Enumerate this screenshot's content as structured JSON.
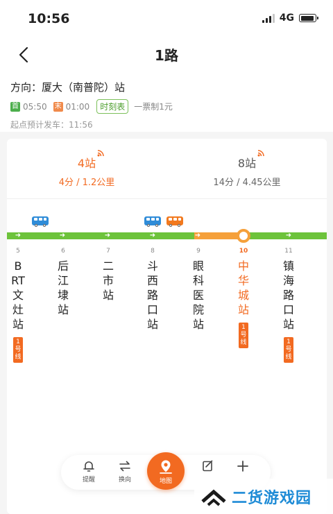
{
  "status_bar": {
    "time": "10:56",
    "network": "4G"
  },
  "header": {
    "title": "1路",
    "back_icon": "chevron-left-icon"
  },
  "route_info": {
    "direction": "方向：厦大（南普陀）站",
    "first_tag": "首",
    "first_time": "05:50",
    "last_tag": "末",
    "last_time": "01:00",
    "timetable_label": "时刻表",
    "fare": "一票制1元",
    "departure": "起点预计发车：11:56"
  },
  "buses": [
    {
      "stops": "4站",
      "eta": "4分 / 1.2公里"
    },
    {
      "stops": "8站",
      "eta": "14分 / 4.45公里"
    }
  ],
  "stations": [
    {
      "num": "5",
      "name": "BRT文灶站",
      "metro": "1号线"
    },
    {
      "num": "6",
      "name": "后江埭站"
    },
    {
      "num": "7",
      "name": "二市站"
    },
    {
      "num": "8",
      "name": "斗西路口站"
    },
    {
      "num": "9",
      "name": "眼科医院站"
    },
    {
      "num": "10",
      "name": "中华城站",
      "metro": "1号线"
    },
    {
      "num": "11",
      "name": "镇海路口站",
      "metro": "1号线"
    }
  ],
  "bottom_nav": {
    "remind": "提醒",
    "switch": "换向",
    "map": "地图"
  },
  "watermark": {
    "text": "二货游戏园"
  },
  "colors": {
    "accent": "#f26a21",
    "route_green": "#6dc33b",
    "bus_blue": "#2f8cd8"
  }
}
